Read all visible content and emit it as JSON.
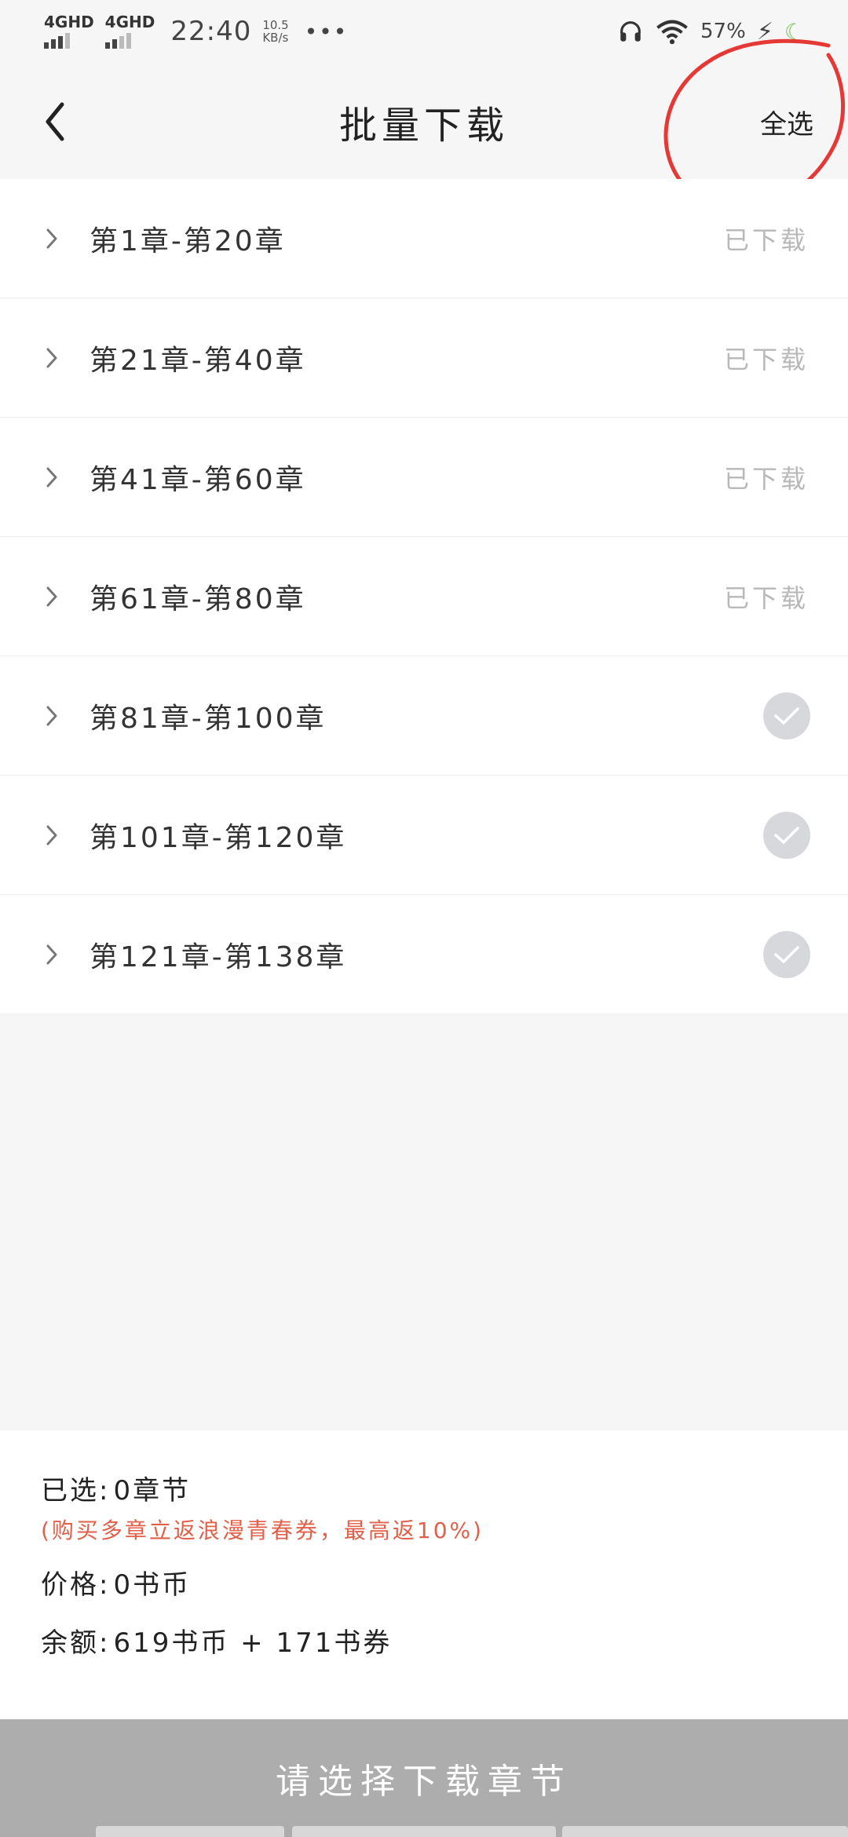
{
  "status_bar": {
    "network1": "4GHD",
    "network2": "4GHD",
    "time": "22:40",
    "speed_value": "10.5",
    "speed_unit": "KB/s",
    "more": "•••",
    "battery": "57%"
  },
  "header": {
    "title": "批量下载",
    "select_all": "全选"
  },
  "chapters": [
    {
      "label": "第1章-第20章",
      "status": "已下载",
      "downloaded": true
    },
    {
      "label": "第21章-第40章",
      "status": "已下载",
      "downloaded": true
    },
    {
      "label": "第41章-第60章",
      "status": "已下载",
      "downloaded": true
    },
    {
      "label": "第61章-第80章",
      "status": "已下载",
      "downloaded": true
    },
    {
      "label": "第81章-第100章",
      "status": "",
      "downloaded": false
    },
    {
      "label": "第101章-第120章",
      "status": "",
      "downloaded": false
    },
    {
      "label": "第121章-第138章",
      "status": "",
      "downloaded": false
    }
  ],
  "summary": {
    "selected_label": "已选:",
    "selected_value": "0章节",
    "promo": "(购买多章立返浪漫青春券，最高返10%)",
    "price_label": "价格:",
    "price_value": "0书币",
    "balance_label": "余额:",
    "balance_value": "619书币 + 171书券"
  },
  "action": {
    "button_label": "请选择下载章节"
  },
  "colors": {
    "annotation": "#e53935",
    "promo": "#e0604a",
    "button_bg": "#adadad",
    "downloaded_text": "#b8b8b8"
  }
}
